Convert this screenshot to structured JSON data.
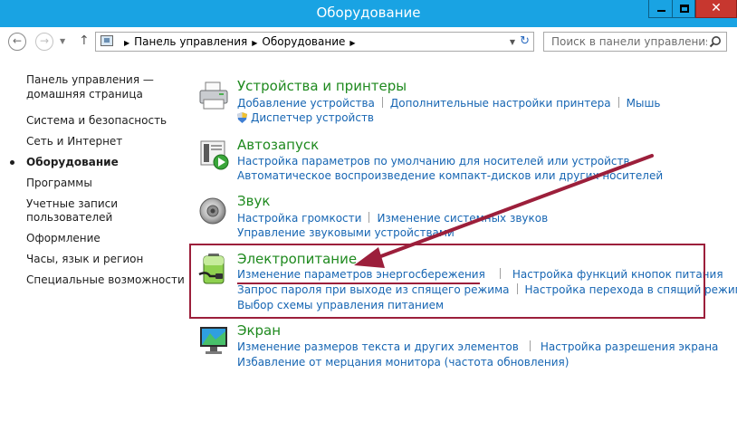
{
  "window": {
    "title": "Оборудование",
    "close_glyph": "✕"
  },
  "nav": {
    "back_glyph": "←",
    "forward_glyph": "→",
    "dropdown_glyph": "▼",
    "up_glyph": "↑",
    "breadcrumbs": [
      "Панель управления",
      "Оборудование"
    ],
    "breadcrumb_sep": "▶",
    "address_dropdown_glyph": "▼",
    "refresh_glyph": "↻",
    "search_placeholder": "Поиск в панели управления",
    "search_icon": "search-icon"
  },
  "sidebar": {
    "home": "Панель управления — домашняя страница",
    "items": [
      "Система и безопасность",
      "Сеть и Интернет",
      "Оборудование",
      "Программы",
      "Учетные записи пользователей",
      "Оформление",
      "Часы, язык и регион",
      "Специальные возможности"
    ],
    "current_index": 2
  },
  "categories": [
    {
      "title": "Устройства и принтеры",
      "icon": "printer-icon",
      "lines": [
        [
          "Добавление устройства",
          "Дополнительные настройки принтера",
          "Мышь"
        ],
        [
          "Диспетчер устройств"
        ]
      ]
    },
    {
      "title": "Автозапуск",
      "icon": "autoplay-icon",
      "lines": [
        [
          "Настройка параметров по умолчанию для носителей или устройств"
        ],
        [
          "Автоматическое воспроизведение компакт-дисков или других носителей"
        ]
      ]
    },
    {
      "title": "Звук",
      "icon": "speaker-icon",
      "lines": [
        [
          "Настройка громкости",
          "Изменение системных звуков"
        ],
        [
          "Управление звуковыми устройствами"
        ]
      ]
    },
    {
      "title": "Электропитание",
      "icon": "battery-icon",
      "lines": [
        [
          "Изменение параметров энергосбережения",
          "Настройка функций кнопок питания"
        ],
        [
          "Запрос пароля при выходе из спящего режима",
          "Настройка перехода в спящий режим"
        ],
        [
          "Выбор схемы управления питанием"
        ]
      ]
    },
    {
      "title": "Экран",
      "icon": "monitor-icon",
      "lines": [
        [
          "Изменение размеров текста и других элементов",
          "Настройка разрешения экрана"
        ],
        [
          "Избавление от мерцания монитора (частота обновления)"
        ]
      ]
    }
  ],
  "colors": {
    "titlebar": "#19a3e3",
    "heading": "#1f8a1f",
    "link": "#1766b3",
    "annotation": "#9c1f3b"
  }
}
